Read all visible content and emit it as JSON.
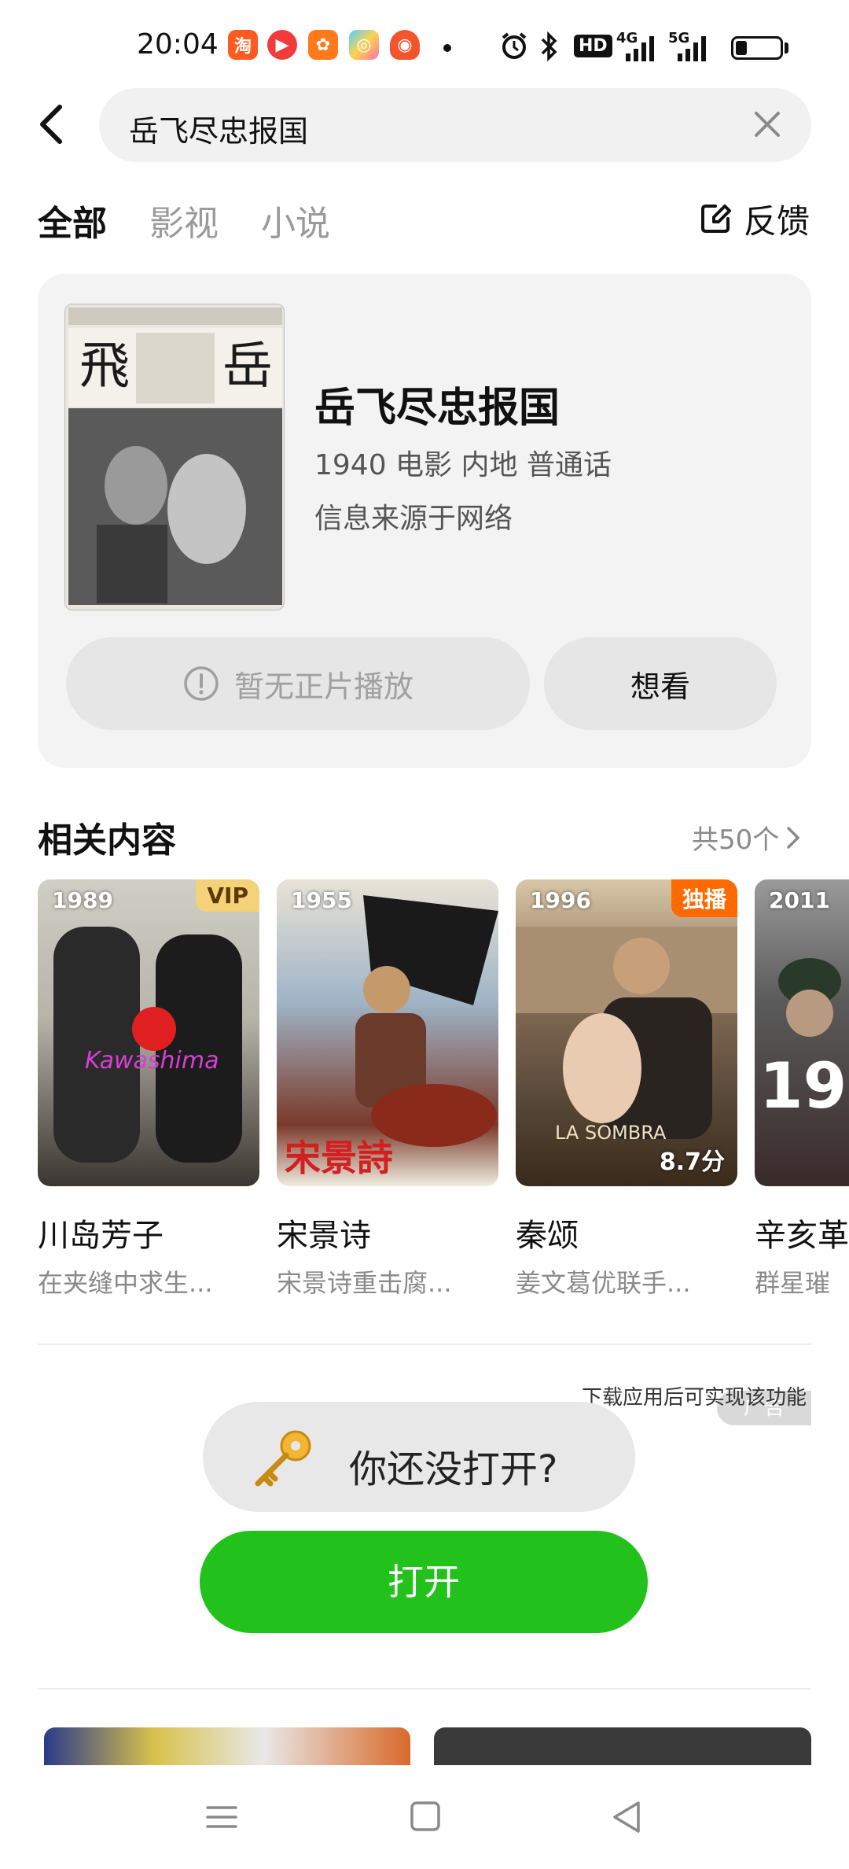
{
  "status_bar": {
    "time": "20:04",
    "app_icons": [
      "taobao-icon",
      "video-app-icon",
      "orange-app-icon",
      "color-app-icon",
      "red-app-icon"
    ],
    "right_icons": [
      "alarm-icon",
      "bluetooth-icon",
      "hd-icon",
      "signal-4g-icon",
      "signal-5g-icon",
      "battery-icon"
    ],
    "hd_label": "HD",
    "sig1_label": "4G",
    "sig2_label": "5G"
  },
  "search": {
    "query": "岳飞尽忠报国"
  },
  "tabs": [
    {
      "label": "全部",
      "active": true
    },
    {
      "label": "影视",
      "active": false
    },
    {
      "label": "小说",
      "active": false
    }
  ],
  "feedback": {
    "label": "反馈"
  },
  "movie": {
    "title": "岳飞尽忠报国",
    "meta": "1940 电影 内地 普通话",
    "source": "信息来源于网络",
    "no_play_label": "暂无正片播放",
    "want_label": "想看"
  },
  "related": {
    "title": "相关内容",
    "count_label": "共50个",
    "items": [
      {
        "year": "1989",
        "badge": "VIP",
        "score": "",
        "name": "川岛芳子",
        "desc": "在夹缝中求生..."
      },
      {
        "year": "1955",
        "badge": "",
        "score": "",
        "name": "宋景诗",
        "desc": "宋景诗重击腐..."
      },
      {
        "year": "1996",
        "badge": "独播",
        "score": "8.7分",
        "name": "秦颂",
        "desc": "姜文葛优联手..."
      },
      {
        "year": "2011",
        "badge": "",
        "score": "",
        "name": "辛亥革",
        "desc": "群星璀"
      }
    ]
  },
  "ad": {
    "note": "下载应用后可实现该功能",
    "tag": "广告",
    "question": "你还没打开?",
    "open_label": "打开"
  },
  "colors": {
    "accent_green": "#22c11c",
    "vip_gold": "#f5d27a",
    "exclusive_orange": "#ff6a00"
  }
}
